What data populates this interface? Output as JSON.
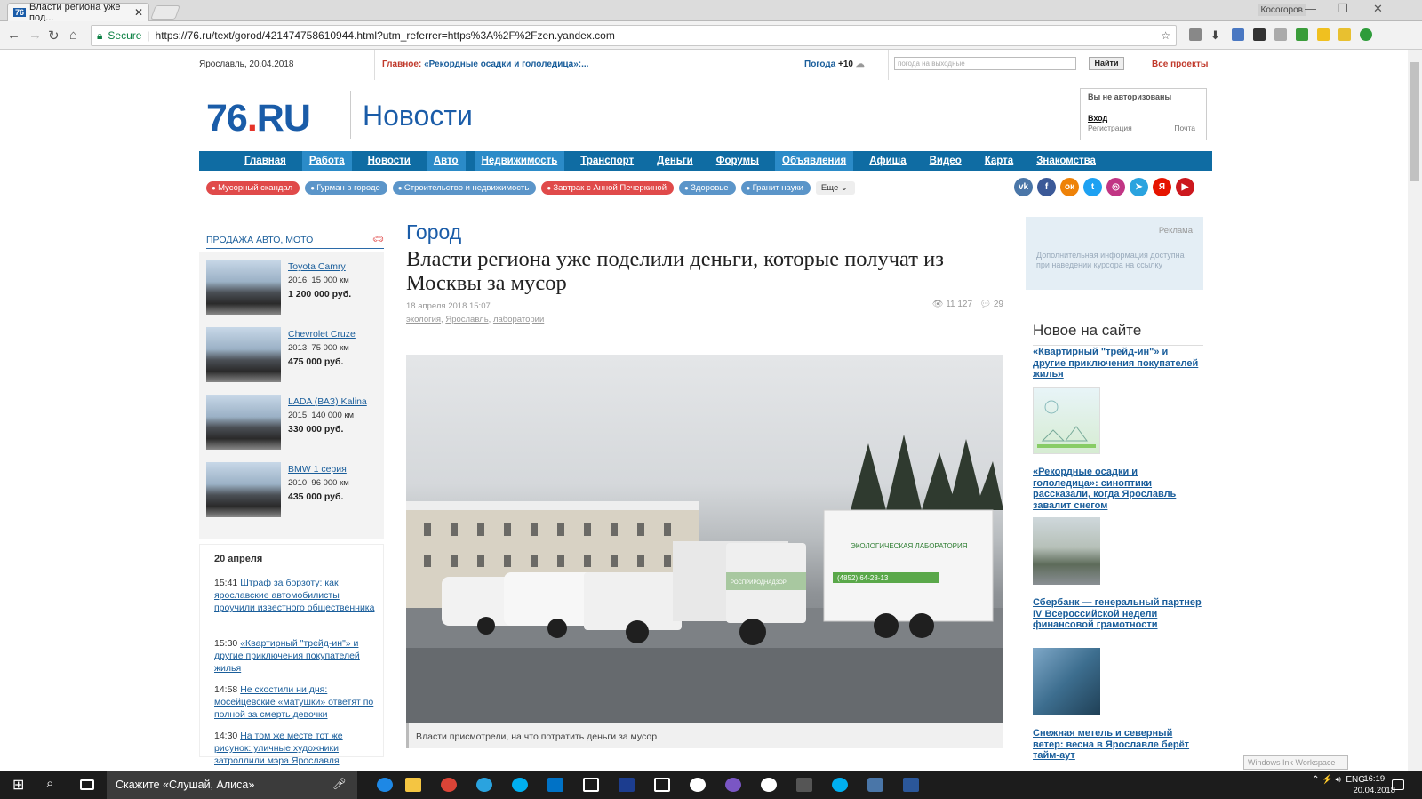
{
  "browser": {
    "tab_title": "Власти региона уже под...",
    "tab_favicon": "76",
    "window_user": "Косогоров",
    "secure_label": "Secure",
    "url": "https://76.ru/text/gorod/421474758610944.html?utm_referrer=https%3A%2F%2Fzen.yandex.com"
  },
  "topbar": {
    "date": "Ярославль, 20.04.2018",
    "main_label": "Главное:",
    "main_link": "«Рекордные осадки и гололедица»:...",
    "weather_label": "Погода",
    "weather_temp": "+10",
    "search_placeholder": "погода на выходные",
    "search_button": "Найти",
    "all_projects": "Все проекты"
  },
  "header": {
    "logo_num": "76",
    "logo_dot": ".",
    "logo_ru": "RU",
    "section": "Новости",
    "login": {
      "not_auth": "Вы не авторизованы",
      "enter": "Вход",
      "register": "Регистрация",
      "mail": "Почта"
    }
  },
  "nav": [
    "Главная",
    "Работа",
    "Новости",
    "Авто",
    "Недвижимость",
    "Транспорт",
    "Деньги",
    "Форумы",
    "Объявления",
    "Афиша",
    "Видео",
    "Карта",
    "Знакомства"
  ],
  "tags": [
    {
      "label": "Мусорный скандал",
      "color": "red"
    },
    {
      "label": "Гурман в городе",
      "color": "blue"
    },
    {
      "label": "Строительство и недвижимость",
      "color": "blue"
    },
    {
      "label": "Завтрак с Анной Печеркиной",
      "color": "red"
    },
    {
      "label": "Здоровье",
      "color": "blue"
    },
    {
      "label": "Гранит науки",
      "color": "blue"
    }
  ],
  "tags_more": "Еще",
  "social": [
    {
      "icon": "vk-icon",
      "glyph": "vk",
      "color": "#4a76a8"
    },
    {
      "icon": "facebook-icon",
      "glyph": "f",
      "color": "#3b5998"
    },
    {
      "icon": "odnoklassniki-icon",
      "glyph": "ок",
      "color": "#ee8208"
    },
    {
      "icon": "twitter-icon",
      "glyph": "t",
      "color": "#1da1f2"
    },
    {
      "icon": "instagram-icon",
      "glyph": "◎",
      "color": "#c13584"
    },
    {
      "icon": "telegram-icon",
      "glyph": "➤",
      "color": "#2aa3df"
    },
    {
      "icon": "yandex-icon",
      "glyph": "Я",
      "color": "#e61400"
    },
    {
      "icon": "youtube-icon",
      "glyph": "▶",
      "color": "#cc181e"
    }
  ],
  "cars": {
    "heading": "ПРОДАЖА АВТО, МОТО",
    "items": [
      {
        "name": "Toyota Camry",
        "details": "2016, 15 000 км",
        "price": "1 200 000 руб."
      },
      {
        "name": "Chevrolet Cruze",
        "details": "2013, 75 000 км",
        "price": "475 000 руб."
      },
      {
        "name": "LADA (ВАЗ) Kalina",
        "details": "2015, 140 000 км",
        "price": "330 000 руб."
      },
      {
        "name": "BMW 1 серия",
        "details": "2010, 96 000 км",
        "price": "435 000 руб."
      }
    ]
  },
  "news_feed": {
    "date": "20 апреля",
    "items": [
      {
        "time": "15:41",
        "title": "Штраф за борзоту: как ярославские автомобилисты проучили известного общественника"
      },
      {
        "time": "15:30",
        "title": "«Квартирный \"трейд-ин\"» и другие приключения покупателей жилья"
      },
      {
        "time": "14:58",
        "title": "Не скостили ни дня: мосейцевские «матушки» ответят по полной за смерть девочки"
      },
      {
        "time": "14:30",
        "title": "На том же месте тот же рисунок: уличные художники затроллили мэра Ярославля"
      }
    ]
  },
  "article": {
    "rubric": "Город",
    "headline": "Власти региона уже поделили деньги, которые получат из Москвы за мусор",
    "date": "18 апреля 2018 15:07",
    "views": "11 127",
    "comments": "29",
    "tags": [
      "экология",
      "Ярославль",
      "лаборатории"
    ],
    "photo_caption": "Власти присмотрели, на что потратить деньги за мусор",
    "truck_text": "ЭКОЛОГИЧЕСКАЯ ЛАБОРАТОРИЯ",
    "truck_phone": "(4852) 64-28-13",
    "truck_label": "РОСПРИРОДНАДЗОР"
  },
  "ad": {
    "label": "Реклама",
    "text": "Дополнительная информация доступна при наведении курсора на ссылку"
  },
  "new_on_site": {
    "heading": "Новое на сайте",
    "items": [
      {
        "title": "«Квартирный \"трейд-ин\"» и другие приключения покупателей жилья"
      },
      {
        "title": "«Рекордные осадки и гололедица»: синоптики рассказали, когда Ярославль завалит снегом"
      },
      {
        "title": "Сбербанк — генеральный партнер IV Всероссийской недели финансовой грамотности"
      },
      {
        "title": "Снежная метель и северный ветер: весна в Ярославле берёт тайм-аут"
      }
    ]
  },
  "ink_workspace": "Windows Ink Workspace",
  "taskbar": {
    "cortana": "Скажите «Слушай, Алиса»",
    "lang": "ENG",
    "time": "16:19",
    "date": "20.04.2018"
  }
}
